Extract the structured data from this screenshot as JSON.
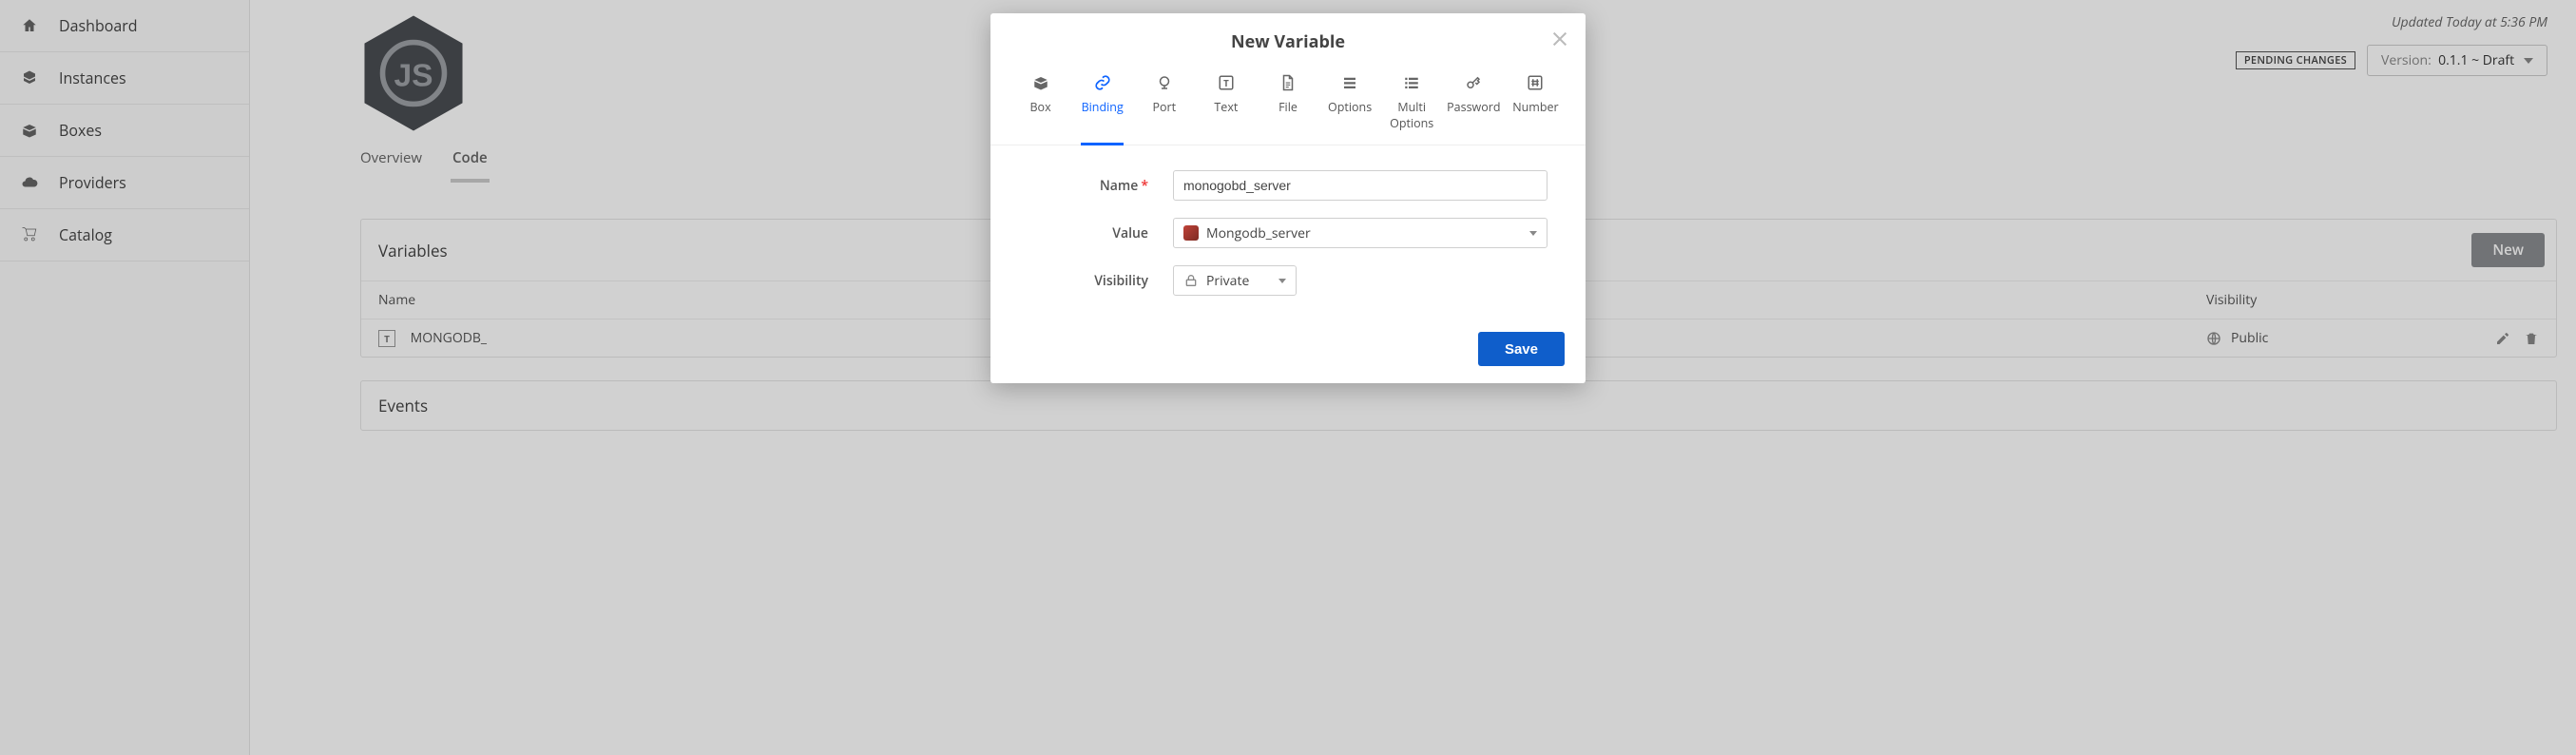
{
  "sidebar": {
    "items": [
      {
        "label": "Dashboard",
        "icon": "home-icon"
      },
      {
        "label": "Instances",
        "icon": "cubes-icon"
      },
      {
        "label": "Boxes",
        "icon": "box-icon"
      },
      {
        "label": "Providers",
        "icon": "cloud-icon"
      },
      {
        "label": "Catalog",
        "icon": "cart-icon"
      }
    ]
  },
  "header": {
    "updated": "Updated Today at 5:36 PM",
    "pending_badge": "PENDING CHANGES",
    "version_label": "Version:",
    "version_value": "0.1.1 ~ Draft"
  },
  "tabs": {
    "items": [
      {
        "label": "Overview",
        "active": false
      },
      {
        "label": "Code",
        "active": true
      }
    ]
  },
  "variables_panel": {
    "title": "Variables",
    "new_button": "New",
    "col_name": "Name",
    "col_visibility": "Visibility",
    "rows": [
      {
        "name": "MONGODB_",
        "visibility": "Public"
      }
    ]
  },
  "events_panel": {
    "title": "Events"
  },
  "modal": {
    "title": "New Variable",
    "type_tabs": [
      {
        "label": "Box",
        "name": "box"
      },
      {
        "label": "Binding",
        "name": "binding",
        "selected": true
      },
      {
        "label": "Port",
        "name": "port"
      },
      {
        "label": "Text",
        "name": "text"
      },
      {
        "label": "File",
        "name": "file"
      },
      {
        "label": "Options",
        "name": "options"
      },
      {
        "label": "Multi Options",
        "name": "multi-options"
      },
      {
        "label": "Password",
        "name": "password"
      },
      {
        "label": "Number",
        "name": "number"
      }
    ],
    "name_label": "Name",
    "name_value": "monogobd_server",
    "value_label": "Value",
    "value_selected": "Mongodb_server",
    "visibility_label": "Visibility",
    "visibility_value": "Private",
    "save_label": "Save"
  }
}
